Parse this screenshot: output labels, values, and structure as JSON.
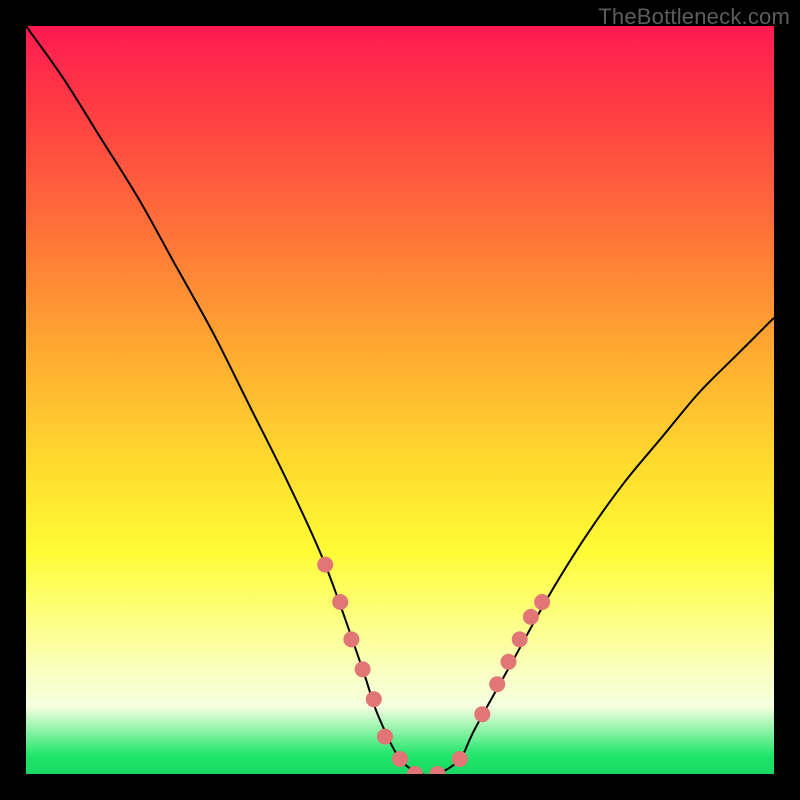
{
  "watermark": "TheBottleneck.com",
  "colors": {
    "frame_border": "#000000",
    "curve_stroke": "#000000",
    "marker_fill": "#e27575",
    "gradient_top": "#ff1a52",
    "gradient_bottom": "#19d862"
  },
  "chart_data": {
    "type": "line",
    "title": "",
    "xlabel": "",
    "ylabel": "",
    "xlim": [
      0,
      100
    ],
    "ylim": [
      0,
      100
    ],
    "grid": false,
    "legend": false,
    "note": "V-shaped bottleneck curve; y = estimated bottleneck percentage (0 = none). Values read from vertical position against image height.",
    "x": [
      0,
      5,
      10,
      15,
      20,
      25,
      30,
      35,
      40,
      45,
      47,
      50,
      53,
      55,
      58,
      60,
      65,
      70,
      75,
      80,
      85,
      90,
      95,
      100
    ],
    "y": [
      100,
      93,
      85,
      77,
      68,
      59,
      49,
      39,
      28,
      14,
      8,
      2,
      0,
      0,
      2,
      6,
      15,
      24,
      32,
      39,
      45,
      51,
      56,
      61
    ],
    "markers": {
      "note": "salmon dots clustered near the trough along both branches",
      "points": [
        {
          "x": 40,
          "y": 28
        },
        {
          "x": 42,
          "y": 23
        },
        {
          "x": 43.5,
          "y": 18
        },
        {
          "x": 45,
          "y": 14
        },
        {
          "x": 46.5,
          "y": 10
        },
        {
          "x": 48,
          "y": 5
        },
        {
          "x": 50,
          "y": 2
        },
        {
          "x": 52,
          "y": 0
        },
        {
          "x": 55,
          "y": 0
        },
        {
          "x": 58,
          "y": 2
        },
        {
          "x": 61,
          "y": 8
        },
        {
          "x": 63,
          "y": 12
        },
        {
          "x": 64.5,
          "y": 15
        },
        {
          "x": 66,
          "y": 18
        },
        {
          "x": 67.5,
          "y": 21
        },
        {
          "x": 69,
          "y": 23
        }
      ]
    }
  }
}
